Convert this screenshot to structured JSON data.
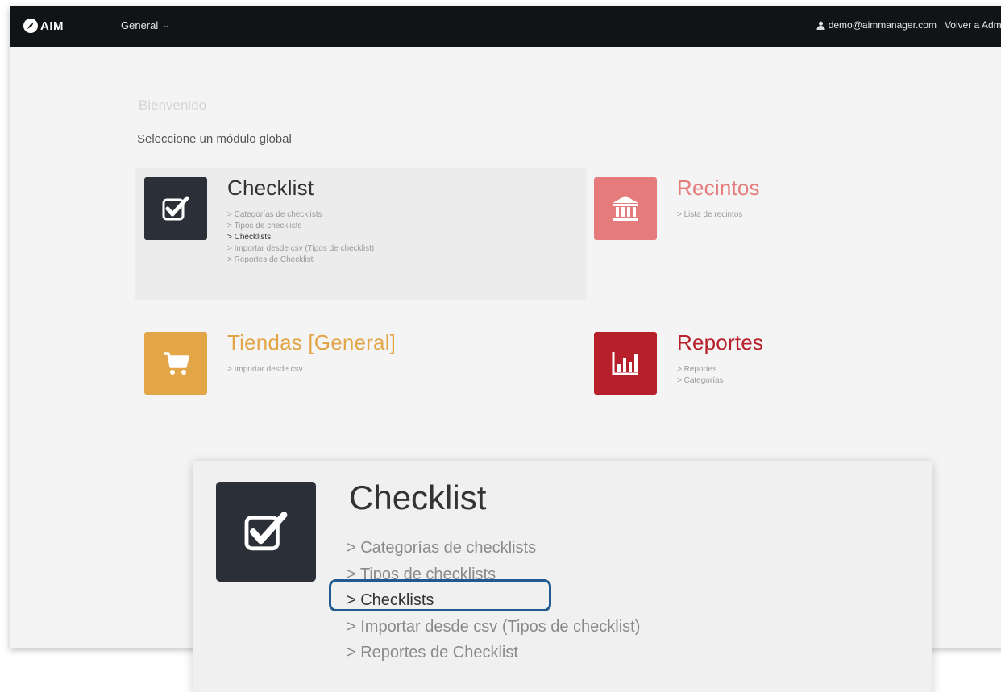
{
  "topbar": {
    "logo_text": "AIM",
    "logo_icon": "compass-icon",
    "nav_label": "General",
    "user_email": "demo@aimmanager.com",
    "back_link": "Volver a Admin"
  },
  "breadcrumb": "Bienvenido",
  "subtitle": "Seleccione un módulo global",
  "modules": {
    "checklist": {
      "title": "Checklist",
      "color": "#2b3038",
      "title_color": "#333333",
      "icon": "checkbox-icon",
      "links": [
        "> Categorías de checklists",
        "> Tipos de checklists",
        "> Checklists",
        "> Importar desde csv (Tipos de checklist)",
        "> Reportes de Checklist"
      ]
    },
    "recintos": {
      "title": "Recintos",
      "color": "#e57b7b",
      "icon": "building-icon",
      "links": [
        "> Lista de recintos"
      ]
    },
    "tiendas": {
      "title": "Tiendas [General]",
      "color": "#e2a548",
      "icon": "cart-icon",
      "links": [
        "> Importar desde csv"
      ]
    },
    "reportes": {
      "title": "Reportes",
      "color": "#b7202a",
      "icon": "bar-chart-icon",
      "links": [
        "> Reportes",
        "> Categorías"
      ]
    }
  },
  "zoom": {
    "title": "Checklist",
    "links": [
      "> Categorías de checklists",
      "> Tipos de checklists",
      "> Checklists",
      "> Importar desde csv (Tipos de checklist)",
      "> Reportes de Checklist"
    ],
    "highlight_color": "#1f5b8e"
  }
}
